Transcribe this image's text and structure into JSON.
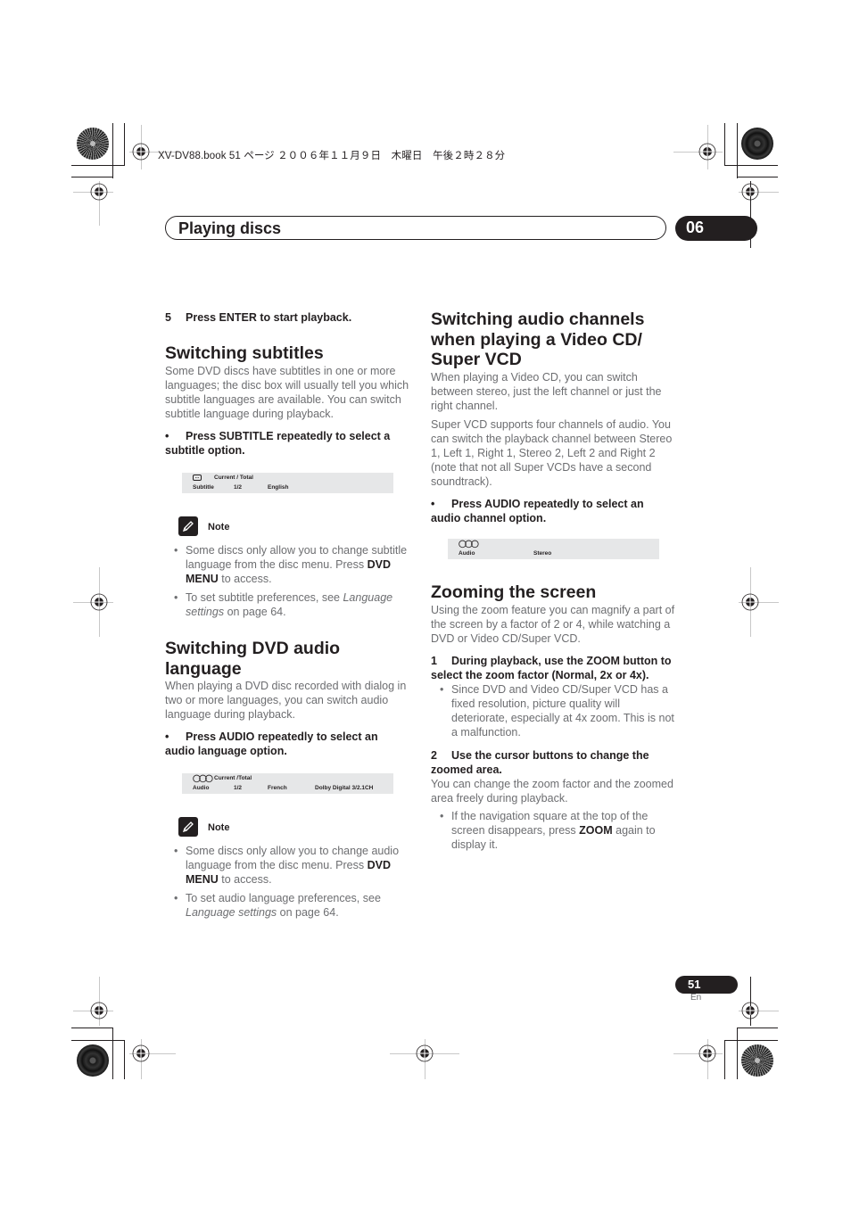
{
  "slug": "XV-DV88.book  51 ページ  ２００６年１１月９日　木曜日　午後２時２８分",
  "header": {
    "title": "Playing discs",
    "chapter": "06"
  },
  "left": {
    "step5": {
      "num": "5",
      "text": "Press ENTER to start playback."
    },
    "subtitles": {
      "heading": "Switching subtitles",
      "body": "Some DVD discs have subtitles in one or more languages; the disc box will usually tell you which subtitle languages are available. You can switch subtitle language during playback.",
      "instruction": "Press SUBTITLE repeatedly to select a subtitle option.",
      "osd": {
        "icon": "subtitle-icon",
        "header": "Current / Total",
        "label": "Subtitle",
        "count": "1/2",
        "value": "English"
      },
      "note": {
        "label": "Note",
        "items": [
          {
            "pre": "Some discs only allow you to change subtitle language from the disc menu. Press ",
            "bold": "DVD MENU",
            "post": " to access."
          },
          {
            "pre": "To set subtitle preferences, see ",
            "italic": "Language settings",
            "post": " on page 64."
          }
        ]
      }
    },
    "audio_lang": {
      "heading": "Switching DVD audio language",
      "body": "When playing a DVD disc recorded with dialog in two or more languages, you can switch audio language during playback.",
      "instruction": "Press AUDIO repeatedly to select an audio language option.",
      "osd": {
        "icon": "audio-icon",
        "header": "Current /Total",
        "label": "Audio",
        "count": "1/2",
        "value": "French",
        "format": "Dolby Digital 3/2.1CH"
      },
      "note": {
        "label": "Note",
        "items": [
          {
            "pre": "Some discs only allow you to change audio language from the disc menu. Press ",
            "bold": "DVD MENU",
            "post": " to access."
          },
          {
            "pre": "To set audio language preferences, see ",
            "italic": "Language settings",
            "post": " on page 64."
          }
        ]
      }
    }
  },
  "right": {
    "vcd": {
      "heading": "Switching audio channels when playing a Video CD/ Super VCD",
      "body1": "When playing a Video CD, you can switch between stereo, just the left channel or just the right channel.",
      "body2": "Super VCD supports four channels of audio. You can switch the playback channel between Stereo 1, Left 1, Right 1, Stereo 2, Left 2 and Right 2 (note that not all Super VCDs have a second soundtrack).",
      "instruction": "Press AUDIO repeatedly to select an audio channel option.",
      "osd": {
        "icon": "audio-icon",
        "label": "Audio",
        "value": "Stereo"
      }
    },
    "zoom": {
      "heading": "Zooming the screen",
      "body": "Using the zoom feature you can magnify a part of the screen by a factor of 2 or 4, while watching a DVD or Video CD/Super VCD.",
      "step1": {
        "num": "1",
        "text": "During playback, use the ZOOM button to select the zoom factor (Normal, 2x or 4x)."
      },
      "step1_bullet": "Since DVD and Video CD/Super VCD has a fixed resolution, picture quality will deteriorate, especially at 4x zoom. This is not a malfunction.",
      "step2": {
        "num": "2",
        "text": "Use the cursor buttons to change the zoomed area."
      },
      "step2_body": "You can change the zoom factor and the zoomed area freely during playback.",
      "step2_bullet": {
        "pre": "If the navigation square at the top of the screen disappears, press ",
        "bold": "ZOOM",
        "post": " again to display it."
      }
    }
  },
  "footer": {
    "page": "51",
    "lang": "En"
  },
  "bullet_char": "•"
}
